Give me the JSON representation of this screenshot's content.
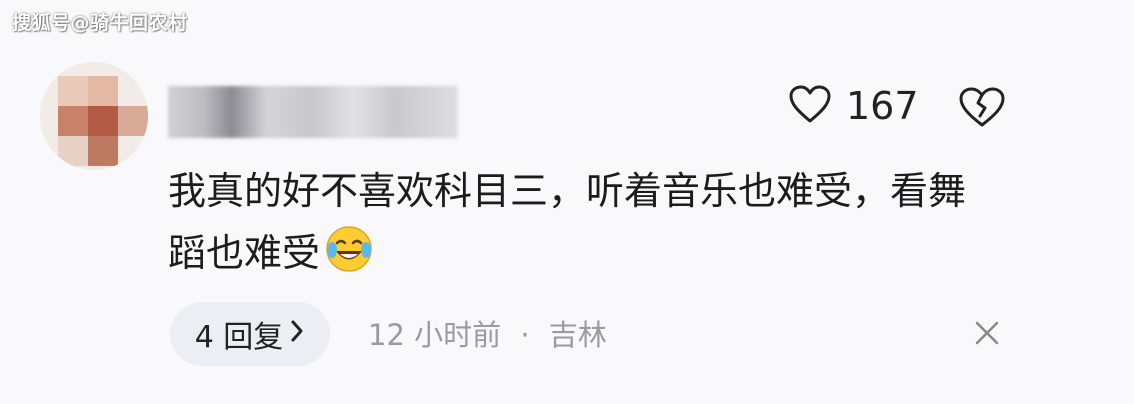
{
  "watermark": "搜狐号@骑牛回农村",
  "comment": {
    "text": "我真的好不喜欢科目三，听着音乐也难受，看舞蹈也难受",
    "emoji": "laughing-crying-emoji"
  },
  "likes": {
    "count": "167"
  },
  "replies": {
    "label": "4 回复",
    "chevron": "›"
  },
  "meta": {
    "time": "12 小时前",
    "separator": "·",
    "location": "吉林"
  },
  "icons": {
    "like": "heart-icon",
    "dislike": "broken-heart-icon",
    "close": "close-icon",
    "reply_arrow": "chevron-right-icon"
  },
  "colors": {
    "background": "#f9f9fb",
    "text": "#222222",
    "meta": "#9a9aa2",
    "pill": "#eceef3"
  }
}
